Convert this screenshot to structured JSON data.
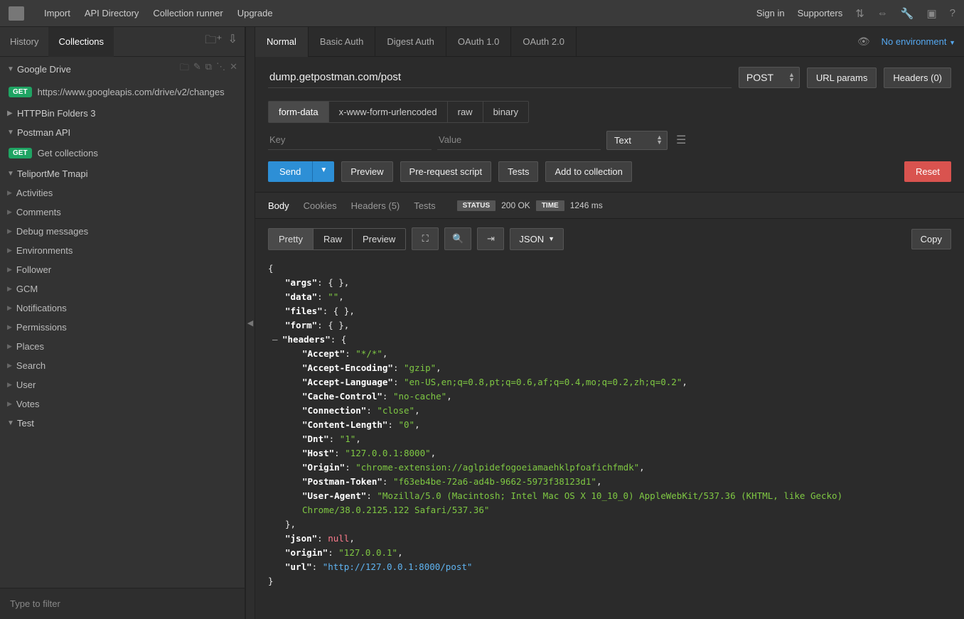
{
  "topbar": {
    "items": [
      "Import",
      "API Directory",
      "Collection runner",
      "Upgrade"
    ],
    "signin": "Sign in",
    "supporters": "Supporters"
  },
  "sidebar": {
    "tabs": {
      "history": "History",
      "collections": "Collections"
    },
    "collections": {
      "gdrive": {
        "name": "Google Drive",
        "req_method": "GET",
        "req_url": "https://www.googleapis.com/drive/v2/changes"
      },
      "httpbin": {
        "name": "HTTPBin Folders 3"
      },
      "postman_api": {
        "name": "Postman API",
        "req_method": "GET",
        "req_label": "Get collections"
      },
      "teliport": {
        "name": "TeliportMe Tmapi",
        "items": [
          "Activities",
          "Comments",
          "Debug messages",
          "Environments",
          "Follower",
          "GCM",
          "Notifications",
          "Permissions",
          "Places",
          "Search",
          "User",
          "Votes"
        ]
      },
      "test": {
        "name": "Test"
      }
    },
    "filter_placeholder": "Type to filter"
  },
  "auth_tabs": [
    "Normal",
    "Basic Auth",
    "Digest Auth",
    "OAuth 1.0",
    "OAuth 2.0"
  ],
  "environment": {
    "label": "No environment"
  },
  "request": {
    "url": "dump.getpostman.com/post",
    "method": "POST",
    "url_params_btn": "URL params",
    "headers_btn": "Headers (0)",
    "body_types": [
      "form-data",
      "x-www-form-urlencoded",
      "raw",
      "binary"
    ],
    "kv": {
      "key_ph": "Key",
      "value_ph": "Value",
      "type": "Text"
    },
    "actions": {
      "send": "Send",
      "preview": "Preview",
      "prerequest": "Pre-request script",
      "tests": "Tests",
      "add": "Add to collection",
      "reset": "Reset"
    }
  },
  "response": {
    "tabs": {
      "body": "Body",
      "cookies": "Cookies",
      "headers": "Headers (5)",
      "tests": "Tests"
    },
    "status_label": "STATUS",
    "status_val": "200 OK",
    "time_label": "TIME",
    "time_val": "1246 ms",
    "view_tabs": [
      "Pretty",
      "Raw",
      "Preview"
    ],
    "lang": "JSON",
    "copy": "Copy",
    "json": {
      "args": "{ }",
      "data": "\"\"",
      "files": "{ }",
      "form": "{ }",
      "headers_open": "{",
      "hdr": {
        "Accept": "*/*",
        "Accept-Encoding": "gzip",
        "Accept-Language": "en-US,en;q=0.8,pt;q=0.6,af;q=0.4,mo;q=0.2,zh;q=0.2",
        "Cache-Control": "no-cache",
        "Connection": "close",
        "Content-Length": "0",
        "Dnt": "1",
        "Host": "127.0.0.1:8000",
        "Origin": "chrome-extension://aglpidefogoeiamaehklpfoafichfmdk",
        "Postman-Token": "f63eb4be-72a6-ad4b-9662-5973f38123d1",
        "User-Agent": "Mozilla/5.0 (Macintosh; Intel Mac OS X 10_10_0) AppleWebKit/537.36 (KHTML, like Gecko) Chrome/38.0.2125.122 Safari/537.36"
      },
      "json": "null",
      "origin": "127.0.0.1",
      "url": "http://127.0.0.1:8000/post"
    }
  }
}
